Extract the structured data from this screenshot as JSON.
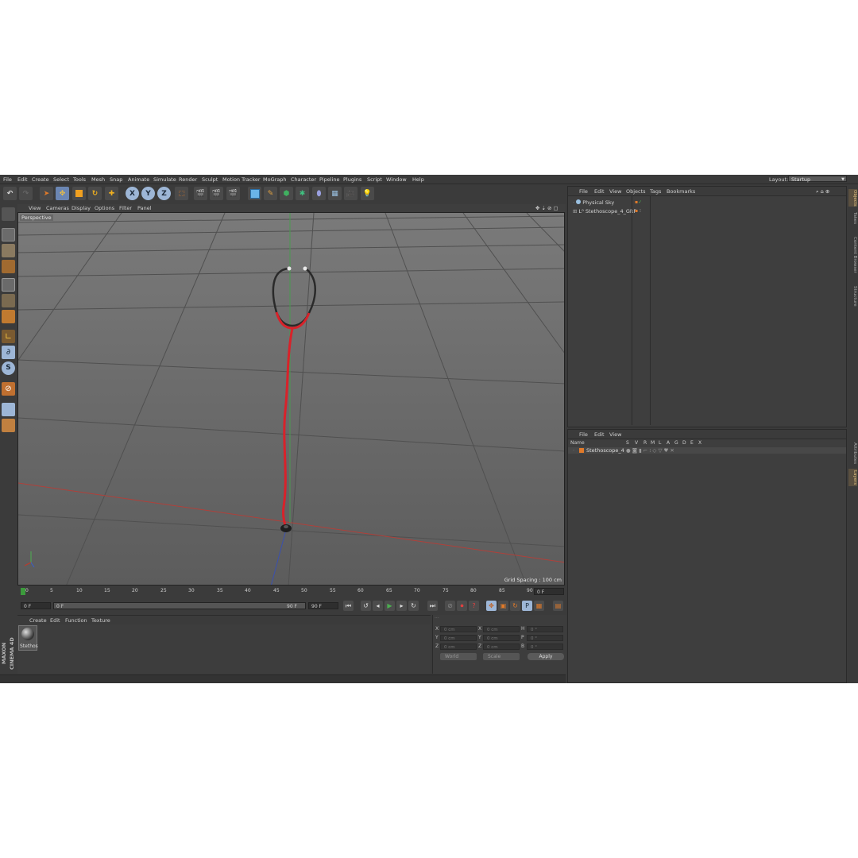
{
  "menubar": {
    "items": [
      "File",
      "Edit",
      "Create",
      "Select",
      "Tools",
      "Mesh",
      "Snap",
      "Animate",
      "Simulate",
      "Render",
      "Sculpt",
      "Motion Tracker",
      "MoGraph",
      "Character",
      "Pipeline",
      "Plugins",
      "Script",
      "Window",
      "Help"
    ],
    "layout_label": "Layout:",
    "layout_value": "Startup"
  },
  "toolbar": {
    "axis_x": "X",
    "axis_y": "Y",
    "axis_z": "Z"
  },
  "viewport": {
    "menu": [
      "View",
      "Cameras",
      "Display",
      "Options",
      "Filter",
      "Panel"
    ],
    "camera_label": "Perspective",
    "grid_spacing": "Grid Spacing : 100 cm"
  },
  "timeline": {
    "ticks": [
      "0",
      "5",
      "10",
      "15",
      "20",
      "25",
      "30",
      "35",
      "40",
      "45",
      "50",
      "55",
      "60",
      "65",
      "70",
      "75",
      "80",
      "85",
      "90"
    ],
    "current_frame": "0 F"
  },
  "transport": {
    "start_field": "0 F",
    "range_start": "0 F",
    "range_end": "90 F",
    "end_field": "90 F"
  },
  "material_manager": {
    "menu": [
      "Create",
      "Edit",
      "Function",
      "Texture"
    ],
    "material_name": "Stethos"
  },
  "coordinates": {
    "rows": [
      {
        "a": "X",
        "av": "0 cm",
        "b": "X",
        "bv": "0 cm",
        "c": "H",
        "cv": "0 °"
      },
      {
        "a": "Y",
        "av": "0 cm",
        "b": "Y",
        "bv": "0 cm",
        "c": "P",
        "cv": "0 °"
      },
      {
        "a": "Z",
        "av": "0 cm",
        "b": "Z",
        "bv": "0 cm",
        "c": "B",
        "cv": "0 °"
      }
    ],
    "mode_world": "World",
    "mode_scale": "Scale",
    "apply_label": "Apply"
  },
  "object_manager": {
    "menu": [
      "File",
      "Edit",
      "View",
      "Objects",
      "Tags",
      "Bookmarks"
    ],
    "objects": [
      "Physical Sky",
      "Stethoscope_4_GRP"
    ]
  },
  "layer_manager": {
    "menu": [
      "File",
      "Edit",
      "View"
    ],
    "columns": [
      "Name",
      "S",
      "V",
      "R",
      "M",
      "L",
      "A",
      "G",
      "D",
      "E",
      "X"
    ],
    "layer_name": "Stethoscope_4"
  },
  "right_tabs": [
    "Objects",
    "Takes",
    "Content Browser",
    "Structure",
    "Attributes",
    "Layers"
  ],
  "brand": "MAXON CINEMA 4D",
  "colors": {
    "accent_orange": "#e07a2a",
    "viewport_bg": "#6a6a6a",
    "tube_red": "#d8222a",
    "x_axis_red": "#c0392b",
    "y_axis_green": "#4caf50",
    "z_axis_blue": "#3a5fcd"
  }
}
